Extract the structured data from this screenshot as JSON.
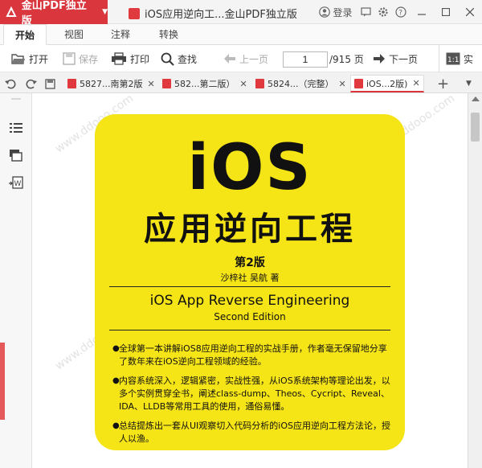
{
  "app": {
    "name": "金山PDF独立版",
    "window_title": "iOS应用逆向工...金山PDF独立版",
    "login_label": "登录",
    "accent_color": "#d9363e"
  },
  "menu_tabs": [
    {
      "label": "开始",
      "active": true
    },
    {
      "label": "视图",
      "active": false
    },
    {
      "label": "注释",
      "active": false
    },
    {
      "label": "转换",
      "active": false
    }
  ],
  "toolbar": {
    "open_label": "打开",
    "save_label": "保存",
    "print_label": "打印",
    "find_label": "查找",
    "prev_label": "上一页",
    "current_page": "1",
    "total_pages": "/915 页",
    "next_label": "下一页",
    "actual_label": "实"
  },
  "doc_tabs": [
    {
      "label": "5827...南第2版",
      "active": false
    },
    {
      "label": "582...第二版）",
      "active": false
    },
    {
      "label": "5824...（完整）",
      "active": false
    },
    {
      "label": "iOS...2版)",
      "active": true
    }
  ],
  "cover": {
    "big_title": "iOS",
    "cn_title": "应用逆向工程",
    "edition": "第2版",
    "author": "沙梓社 吴航 著",
    "en_title": "iOS App Reverse Engineering",
    "en_subtitle": "Second Edition",
    "bullets": [
      "全球第一本讲解iOS8应用逆向工程的实战手册，作者毫无保留地分享了数年来在iOS逆向工程领域的经验。",
      "内容系统深入，逻辑紧密，实战性强，从iOS系统架构等理论出发，以多个实例贯穿全书，阐述class-dump、Theos、Cycript、Reveal、IDA、LLDB等常用工具的使用，通俗易懂。",
      "总结提炼出一套从UI观察切入代码分析的iOS应用逆向工程方法论，授人以渔。"
    ],
    "cover_color": "#f5e416"
  },
  "watermark": "www.ddooo.com"
}
